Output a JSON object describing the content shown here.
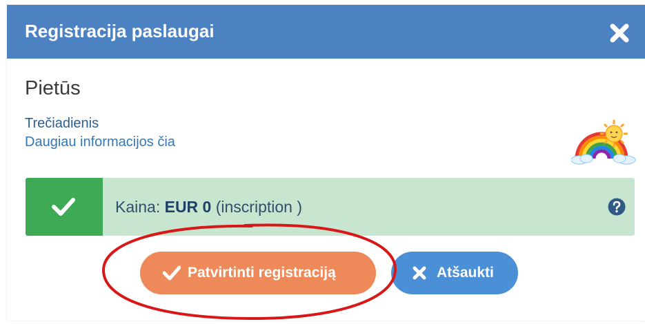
{
  "dialog": {
    "title": "Registracija paslaugai",
    "close_icon": "close-icon"
  },
  "service": {
    "name": "Pietūs",
    "day": "Trečiadienis",
    "more_info_link": "Daugiau informacijos čia",
    "image_icon": "rainbow-sun-icon"
  },
  "price": {
    "label": "Kaina: ",
    "amount": "EUR 0",
    "note": " (inscription )",
    "status_icon": "check-icon",
    "help_icon": "question-circle-icon"
  },
  "actions": {
    "confirm_label": "Patvirtinti registraciją",
    "confirm_icon": "check-icon",
    "cancel_label": "Atšaukti",
    "cancel_icon": "times-icon"
  },
  "colors": {
    "header": "#4d82c2",
    "success": "#3eaa55",
    "success_bg": "#c8e6cf",
    "confirm": "#ee8a59",
    "cancel": "#4b8fd6",
    "annotation": "#d81818"
  }
}
